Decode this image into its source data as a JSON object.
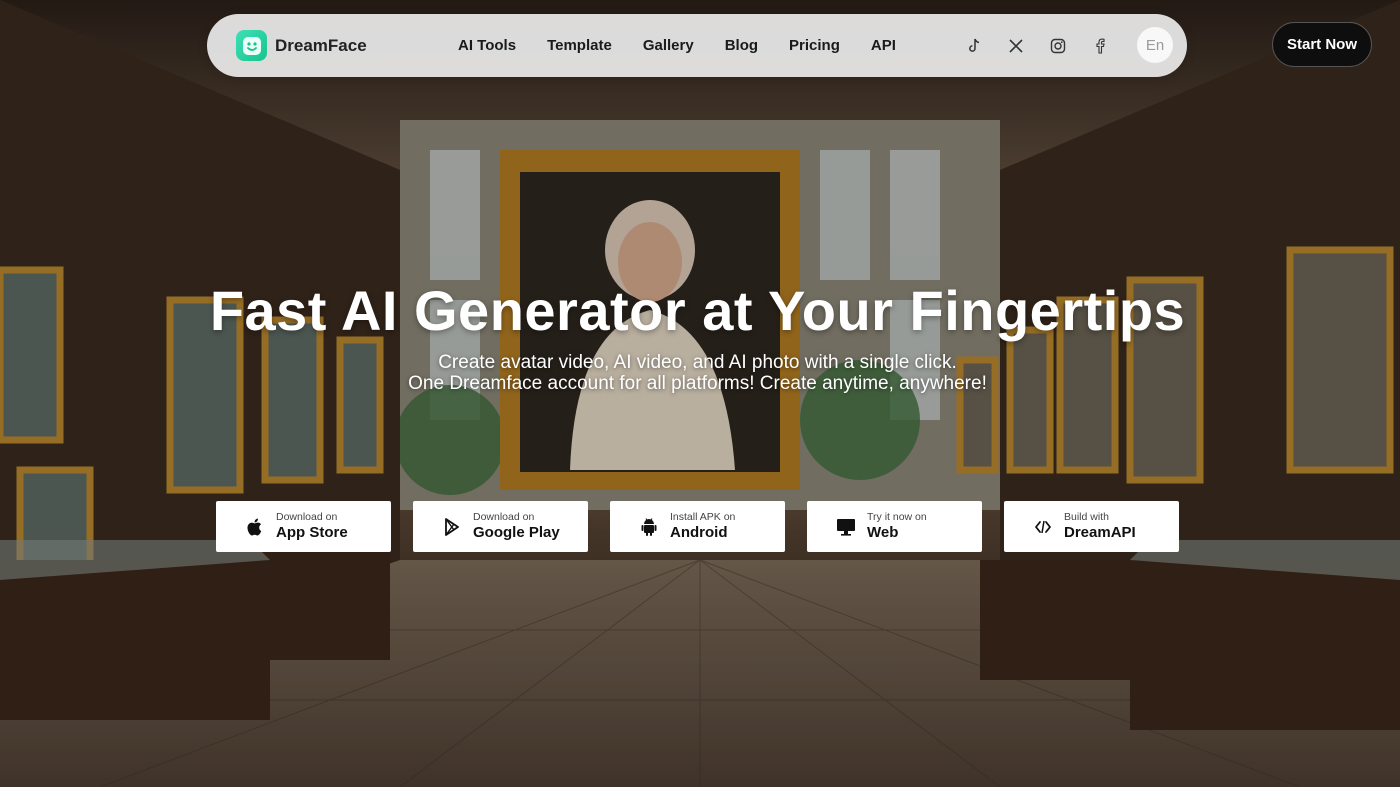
{
  "brand": {
    "name": "DreamFace"
  },
  "nav": {
    "items": [
      "AI Tools",
      "Template",
      "Gallery",
      "Blog",
      "Pricing",
      "API"
    ],
    "socials": [
      "tiktok-icon",
      "x-icon",
      "instagram-icon",
      "facebook-icon"
    ],
    "language": "En"
  },
  "cta": {
    "start_label": "Start Now"
  },
  "hero": {
    "title": "Fast AI Generator at Your Fingertips",
    "subtitle_line1": "Create avatar video, AI video, and AI photo with a single click.",
    "subtitle_line2": "One Dreamface account for all platforms! Create anytime, anywhere!"
  },
  "downloads": [
    {
      "small": "Download on",
      "big": "App Store",
      "icon": "apple-icon"
    },
    {
      "small": "Download on",
      "big": "Google Play",
      "icon": "google-play-icon"
    },
    {
      "small": "Install APK on",
      "big": "Android",
      "icon": "android-icon"
    },
    {
      "small": "Try it now on",
      "big": "Web",
      "icon": "monitor-icon"
    },
    {
      "small": "Build with",
      "big": "DreamAPI",
      "icon": "code-icon"
    }
  ],
  "colors": {
    "accent": "#19c38e",
    "cta_bg": "#0e0e0e",
    "nav_bg": "#ebebeb"
  }
}
